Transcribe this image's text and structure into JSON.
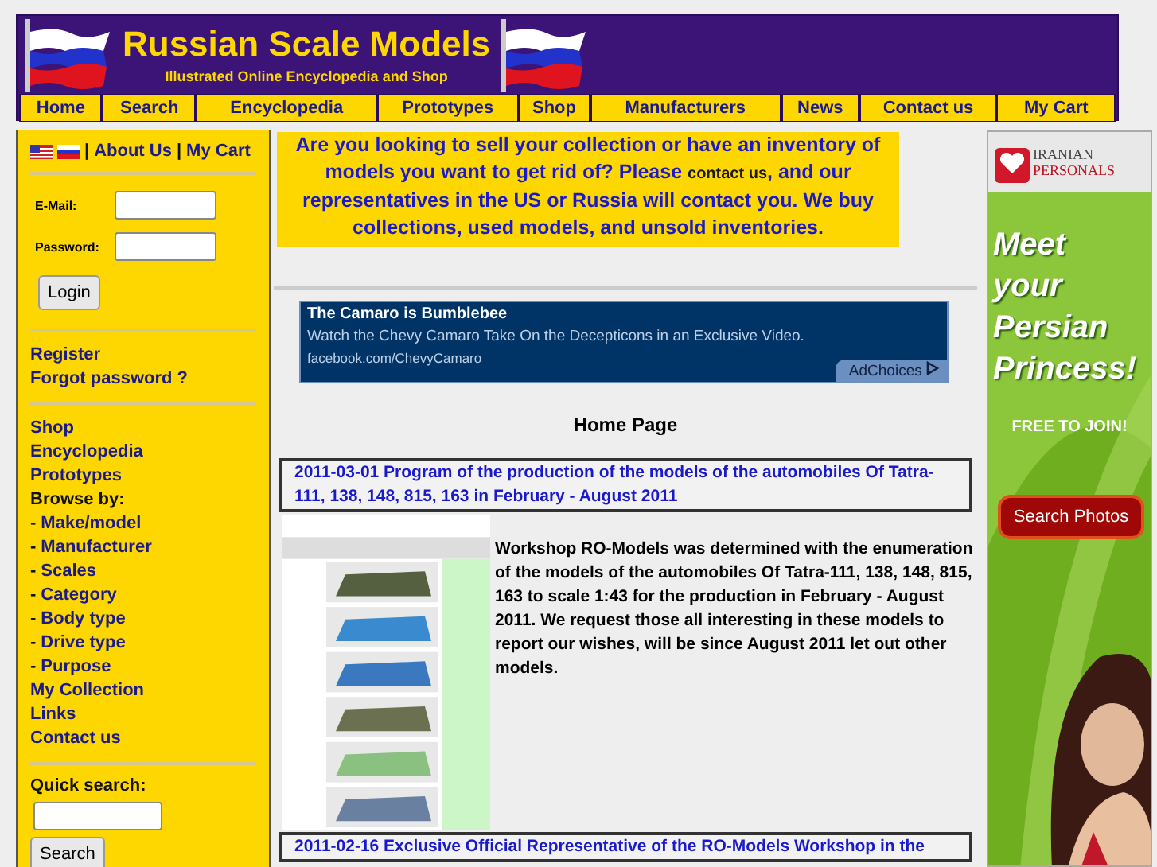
{
  "header": {
    "title": "Russian Scale Models",
    "subtitle": "Illustrated Online Encyclopedia and Shop"
  },
  "nav": [
    {
      "label": "Home"
    },
    {
      "label": "Search"
    },
    {
      "label": "Encyclopedia"
    },
    {
      "label": "Prototypes"
    },
    {
      "label": "Shop"
    },
    {
      "label": "Manufacturers"
    },
    {
      "label": "News"
    },
    {
      "label": "Contact us"
    },
    {
      "label": "My Cart"
    }
  ],
  "sidebar": {
    "separator": "|",
    "top_links": [
      "About Us",
      "My Cart"
    ],
    "login": {
      "email_label": "E-Mail:",
      "password_label": "Password:",
      "button": "Login"
    },
    "account_links": [
      "Register",
      "Forgot password ?"
    ],
    "menu": [
      {
        "kind": "link",
        "label": "Shop"
      },
      {
        "kind": "link",
        "label": "Encyclopedia"
      },
      {
        "kind": "link",
        "label": "Prototypes"
      },
      {
        "kind": "heading",
        "label": "Browse by:",
        "bullet": "-",
        "children": [
          {
            "label": "Make/model"
          },
          {
            "label": "Manufacturer"
          },
          {
            "label": "Scales"
          },
          {
            "label": "Category"
          },
          {
            "label": "Body type"
          },
          {
            "label": "Drive type"
          },
          {
            "label": "Purpose"
          }
        ]
      },
      {
        "kind": "link",
        "label": "My Collection"
      },
      {
        "kind": "link",
        "label": "Links"
      },
      {
        "kind": "link",
        "label": "Contact us"
      }
    ],
    "quick_search": {
      "label": "Quick search:",
      "button": "Search"
    }
  },
  "promo": {
    "before": "Are you looking to sell your collection or have an inventory of models you want to get rid of? Please ",
    "link": "contact us",
    "after": ", and our representatives in the US or Russia will contact you. We buy collections, used models, and unsold inventories."
  },
  "text_ad": {
    "title": "The Camaro is Bumblebee",
    "body": "Watch the Chevy Camaro Take On the Decepticons in an Exclusive Video.",
    "url": "facebook.com/ChevyCamaro",
    "badge": "AdChoices"
  },
  "page_title": "Home Page",
  "news": [
    {
      "title": "2011-03-01 Program of the production of the models of the automobiles Of Tatra-111, 138, 148, 815, 163 in February - August 2011",
      "body": "Workshop RO-Models was determined with the enumeration of the models of the automobiles Of Tatra-111, 138, 148, 815, 163 to scale 1:43 for the production in February - August 2011. We request those all interesting in these models to report our wishes, will be since August 2011 let out other models."
    },
    {
      "title": "2011-02-16 Exclusive Official Representative of the RO-Models Workshop in the"
    }
  ],
  "banner_ad": {
    "brand_top": "IRANIAN",
    "brand_bottom": "PERSONALS",
    "headline": "Meet your Persian Princess!",
    "tagline": "FREE TO JOIN!",
    "button": "Search Photos"
  }
}
